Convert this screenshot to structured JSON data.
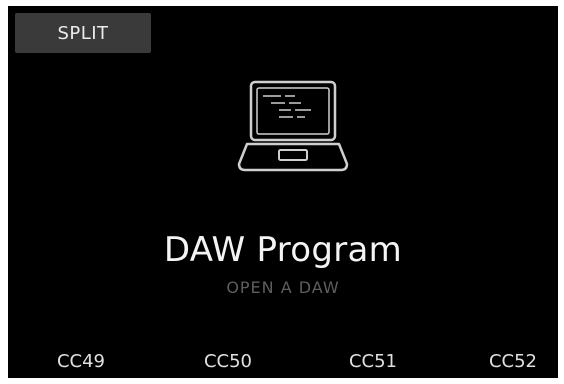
{
  "header": {
    "mode_button_label": "SPLIT"
  },
  "main": {
    "icon": "laptop-icon",
    "title": "DAW Program",
    "hint": "OPEN A DAW"
  },
  "footer": {
    "controls": [
      {
        "label": "CC49"
      },
      {
        "label": "CC50"
      },
      {
        "label": "CC51"
      },
      {
        "label": "CC52"
      }
    ]
  },
  "colors": {
    "background": "#000000",
    "button_background": "#3a3a3a",
    "text_primary": "#f4f4f4",
    "text_dim": "#5e5e5e",
    "icon_stroke": "#cfcfcf"
  }
}
